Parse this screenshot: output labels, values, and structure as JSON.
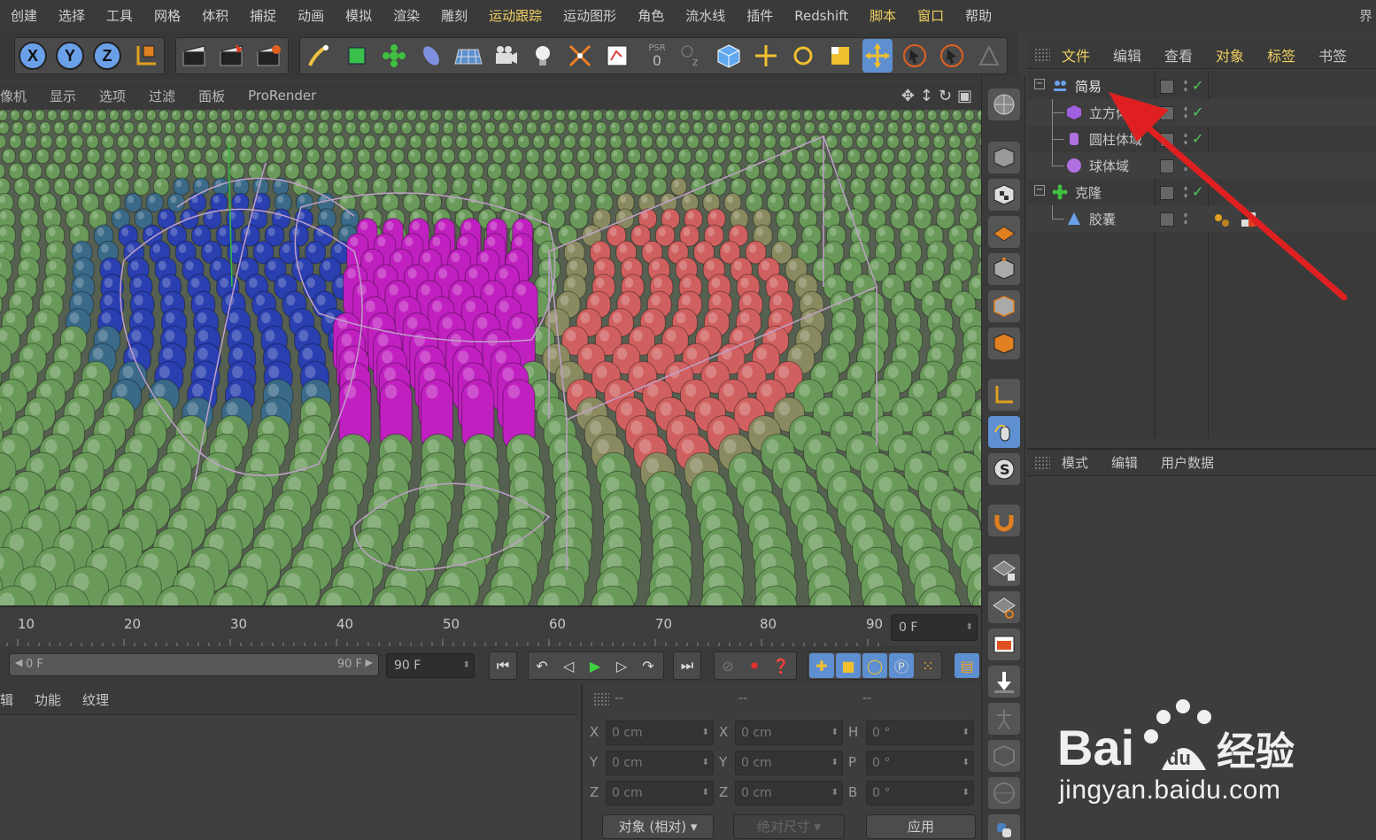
{
  "menubar": {
    "items": [
      "创建",
      "选择",
      "工具",
      "网格",
      "体积",
      "捕捉",
      "动画",
      "模拟",
      "渲染",
      "雕刻",
      "运动跟踪",
      "运动图形",
      "角色",
      "流水线",
      "插件",
      "Redshift",
      "脚本",
      "窗口",
      "帮助"
    ],
    "edge": "界"
  },
  "toolbar": {
    "axis_x": "X",
    "axis_y": "Y",
    "axis_z": "Z",
    "psr_label": "PSR",
    "psr_value": "0"
  },
  "viewport": {
    "menus": [
      "像机",
      "显示",
      "选项",
      "过滤",
      "面板",
      "ProRender"
    ]
  },
  "timeline": {
    "ticks": [
      "10",
      "20",
      "30",
      "40",
      "50",
      "60",
      "70",
      "80",
      "90"
    ],
    "current_frame": "0 F"
  },
  "transport": {
    "range_start": "0 F",
    "range_end": "90 F",
    "end_frame": "90 F"
  },
  "material": {
    "tabs": [
      "辑",
      "功能",
      "纹理"
    ]
  },
  "coords": {
    "head": [
      "--",
      "--",
      "--"
    ],
    "pos_labels": [
      "X",
      "Y",
      "Z"
    ],
    "pos_values": [
      "0 cm",
      "0 cm",
      "0 cm"
    ],
    "size_labels": [
      "X",
      "Y",
      "Z"
    ],
    "size_values": [
      "0 cm",
      "0 cm",
      "0 cm"
    ],
    "rot_labels": [
      "H",
      "P",
      "B"
    ],
    "rot_values": [
      "0 °",
      "0 °",
      "0 °"
    ],
    "mode_dropdown": "对象 (相对)",
    "size_dropdown": "绝对尺寸",
    "apply": "应用"
  },
  "object_manager": {
    "tabs": [
      "文件",
      "编辑",
      "查看",
      "对象",
      "标签",
      "书签"
    ],
    "objects": [
      {
        "name": "简易"
      },
      {
        "name": "立方体域"
      },
      {
        "name": "圆柱体域"
      },
      {
        "name": "球体域"
      },
      {
        "name": "克隆"
      },
      {
        "name": "胶囊"
      }
    ]
  },
  "attribute_manager": {
    "tabs": [
      "模式",
      "编辑",
      "用户数据"
    ]
  },
  "watermark": {
    "text": "jingyan.baidu.com"
  },
  "colors": {
    "accent_yellow": "#f0d060",
    "axis_blue": "#6aa0e8",
    "capsule_green": "#6a9a5a",
    "capsule_blue": "#2a3fb0",
    "capsule_magenta": "#c020c0",
    "capsule_red": "#d06060",
    "arrow_red": "#e02020"
  }
}
